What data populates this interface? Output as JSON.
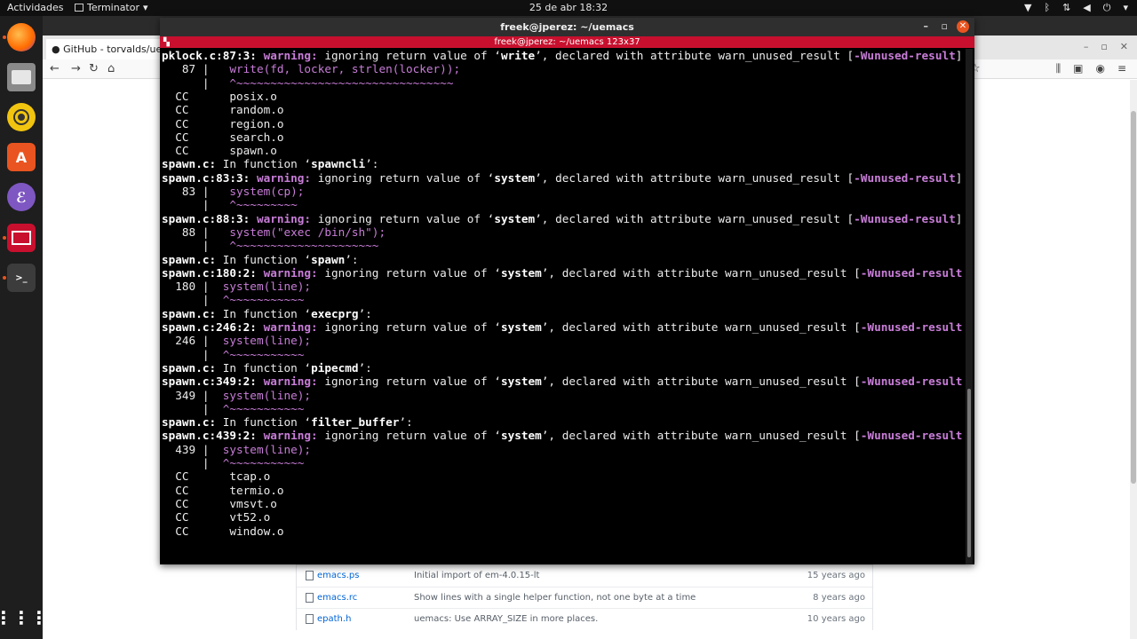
{
  "topbar": {
    "activities": "Actividades",
    "app_name": "Terminator",
    "clock": "25 de abr  18:32",
    "tray_icons": [
      "wifi-icon",
      "bluetooth-icon",
      "network-icon",
      "volume-icon",
      "power-icon",
      "chevron-down-icon"
    ]
  },
  "dock": {
    "items": [
      "firefox-icon",
      "files-icon",
      "rhythmbox-icon",
      "software-icon",
      "emacs-icon",
      "terminator-icon",
      "terminal-icon"
    ],
    "show_apps": "apps-grid-icon"
  },
  "browser": {
    "tab_title": "GitHub - torvalds/uemacs",
    "files": [
      {
        "name": "emacs.ps",
        "message": "Initial import of em-4.0.15-lt",
        "age": "15 years ago"
      },
      {
        "name": "emacs.rc",
        "message": "Show lines with a single helper function, not one byte at a time",
        "age": "8 years ago"
      },
      {
        "name": "epath.h",
        "message": "uemacs: Use ARRAY_SIZE in more places.",
        "age": "10 years ago"
      }
    ]
  },
  "terminal": {
    "window_title": "freek@jperez: ~/uemacs",
    "pane_title": "freek@jperez: ~/uemacs 123x37",
    "lines": [
      {
        "segs": [
          [
            "b",
            "pklock.c:87:3: "
          ],
          [
            "warn",
            "warning: "
          ],
          [
            "",
            "ignoring return value of ‘"
          ],
          [
            "b",
            "write"
          ],
          [
            "",
            "’, declared with attribute warn_unused_result ["
          ],
          [
            "flag",
            "-Wunused-result"
          ],
          [
            "",
            "]"
          ]
        ]
      },
      {
        "segs": [
          [
            "",
            "   87 |   "
          ],
          [
            "code",
            "write(fd, locker, strlen(locker));"
          ]
        ]
      },
      {
        "segs": [
          [
            "",
            "      |   "
          ],
          [
            "caret",
            "^~~~~~~~~~~~~~~~~~~~~~~~~~~~~~~~~"
          ]
        ]
      },
      {
        "segs": [
          [
            "",
            "  CC      posix.o"
          ]
        ]
      },
      {
        "segs": [
          [
            "",
            "  CC      random.o"
          ]
        ]
      },
      {
        "segs": [
          [
            "",
            "  CC      region.o"
          ]
        ]
      },
      {
        "segs": [
          [
            "",
            "  CC      search.o"
          ]
        ]
      },
      {
        "segs": [
          [
            "",
            "  CC      spawn.o"
          ]
        ]
      },
      {
        "segs": [
          [
            "b",
            "spawn.c:"
          ],
          [
            "",
            " In function ‘"
          ],
          [
            "b",
            "spawncli"
          ],
          [
            "",
            "’:"
          ]
        ]
      },
      {
        "segs": [
          [
            "b",
            "spawn.c:83:3: "
          ],
          [
            "warn",
            "warning: "
          ],
          [
            "",
            "ignoring return value of ‘"
          ],
          [
            "b",
            "system"
          ],
          [
            "",
            "’, declared with attribute warn_unused_result ["
          ],
          [
            "flag",
            "-Wunused-result"
          ],
          [
            "",
            "]"
          ]
        ]
      },
      {
        "segs": [
          [
            "",
            "   83 |   "
          ],
          [
            "code",
            "system(cp);"
          ]
        ]
      },
      {
        "segs": [
          [
            "",
            "      |   "
          ],
          [
            "caret",
            "^~~~~~~~~~"
          ]
        ]
      },
      {
        "segs": [
          [
            "b",
            "spawn.c:88:3: "
          ],
          [
            "warn",
            "warning: "
          ],
          [
            "",
            "ignoring return value of ‘"
          ],
          [
            "b",
            "system"
          ],
          [
            "",
            "’, declared with attribute warn_unused_result ["
          ],
          [
            "flag",
            "-Wunused-result"
          ],
          [
            "",
            "]"
          ]
        ]
      },
      {
        "segs": [
          [
            "",
            "   88 |   "
          ],
          [
            "code",
            "system(\"exec /bin/sh\");"
          ]
        ]
      },
      {
        "segs": [
          [
            "",
            "      |   "
          ],
          [
            "caret",
            "^~~~~~~~~~~~~~~~~~~~~~"
          ]
        ]
      },
      {
        "segs": [
          [
            "b",
            "spawn.c:"
          ],
          [
            "",
            " In function ‘"
          ],
          [
            "b",
            "spawn"
          ],
          [
            "",
            "’:"
          ]
        ]
      },
      {
        "segs": [
          [
            "b",
            "spawn.c:180:2: "
          ],
          [
            "warn",
            "warning: "
          ],
          [
            "",
            "ignoring return value of ‘"
          ],
          [
            "b",
            "system"
          ],
          [
            "",
            "’, declared with attribute warn_unused_result ["
          ],
          [
            "flag",
            "-Wunused-result"
          ],
          [
            "",
            "]"
          ]
        ]
      },
      {
        "segs": [
          [
            "",
            "  180 |  "
          ],
          [
            "code",
            "system(line);"
          ]
        ]
      },
      {
        "segs": [
          [
            "",
            "      |  "
          ],
          [
            "caret",
            "^~~~~~~~~~~~"
          ]
        ]
      },
      {
        "segs": [
          [
            "b",
            "spawn.c:"
          ],
          [
            "",
            " In function ‘"
          ],
          [
            "b",
            "execprg"
          ],
          [
            "",
            "’:"
          ]
        ]
      },
      {
        "segs": [
          [
            "b",
            "spawn.c:246:2: "
          ],
          [
            "warn",
            "warning: "
          ],
          [
            "",
            "ignoring return value of ‘"
          ],
          [
            "b",
            "system"
          ],
          [
            "",
            "’, declared with attribute warn_unused_result ["
          ],
          [
            "flag",
            "-Wunused-result"
          ],
          [
            "",
            "]"
          ]
        ]
      },
      {
        "segs": [
          [
            "",
            "  246 |  "
          ],
          [
            "code",
            "system(line);"
          ]
        ]
      },
      {
        "segs": [
          [
            "",
            "      |  "
          ],
          [
            "caret",
            "^~~~~~~~~~~~"
          ]
        ]
      },
      {
        "segs": [
          [
            "b",
            "spawn.c:"
          ],
          [
            "",
            " In function ‘"
          ],
          [
            "b",
            "pipecmd"
          ],
          [
            "",
            "’:"
          ]
        ]
      },
      {
        "segs": [
          [
            "b",
            "spawn.c:349:2: "
          ],
          [
            "warn",
            "warning: "
          ],
          [
            "",
            "ignoring return value of ‘"
          ],
          [
            "b",
            "system"
          ],
          [
            "",
            "’, declared with attribute warn_unused_result ["
          ],
          [
            "flag",
            "-Wunused-result"
          ],
          [
            "",
            "]"
          ]
        ]
      },
      {
        "segs": [
          [
            "",
            "  349 |  "
          ],
          [
            "code",
            "system(line);"
          ]
        ]
      },
      {
        "segs": [
          [
            "",
            "      |  "
          ],
          [
            "caret",
            "^~~~~~~~~~~~"
          ]
        ]
      },
      {
        "segs": [
          [
            "b",
            "spawn.c:"
          ],
          [
            "",
            " In function ‘"
          ],
          [
            "b",
            "filter_buffer"
          ],
          [
            "",
            "’:"
          ]
        ]
      },
      {
        "segs": [
          [
            "b",
            "spawn.c:439:2: "
          ],
          [
            "warn",
            "warning: "
          ],
          [
            "",
            "ignoring return value of ‘"
          ],
          [
            "b",
            "system"
          ],
          [
            "",
            "’, declared with attribute warn_unused_result ["
          ],
          [
            "flag",
            "-Wunused-result"
          ],
          [
            "",
            "]"
          ]
        ]
      },
      {
        "segs": [
          [
            "",
            "  439 |  "
          ],
          [
            "code",
            "system(line);"
          ]
        ]
      },
      {
        "segs": [
          [
            "",
            "      |  "
          ],
          [
            "caret",
            "^~~~~~~~~~~~"
          ]
        ]
      },
      {
        "segs": [
          [
            "",
            "  CC      tcap.o"
          ]
        ]
      },
      {
        "segs": [
          [
            "",
            "  CC      termio.o"
          ]
        ]
      },
      {
        "segs": [
          [
            "",
            "  CC      vmsvt.o"
          ]
        ]
      },
      {
        "segs": [
          [
            "",
            "  CC      vt52.o"
          ]
        ]
      },
      {
        "segs": [
          [
            "",
            "  CC      window.o"
          ]
        ]
      }
    ]
  },
  "colors": {
    "accent_orange": "#e95420",
    "terminal_title_red": "#c8102e",
    "warning_magenta": "#c87dd8"
  }
}
